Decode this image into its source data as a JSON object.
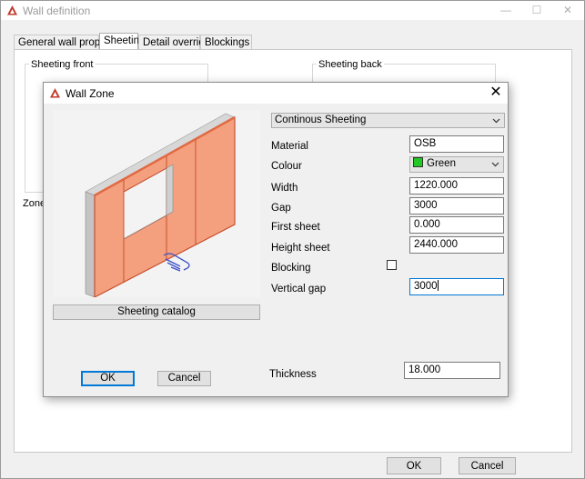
{
  "window": {
    "title": "Wall definition",
    "minimize_glyph": "—",
    "maximize_glyph": "☐",
    "close_glyph": "✕"
  },
  "tabs": [
    {
      "label": "General wall properties"
    },
    {
      "label": "Sheeting"
    },
    {
      "label": "Detail overrides"
    },
    {
      "label": "Blockings"
    }
  ],
  "sheeting_tab": {
    "front_label": "Sheeting front",
    "back_label": "Sheeting back",
    "zones_label": "Zones"
  },
  "main_buttons": {
    "ok": "OK",
    "cancel": "Cancel"
  },
  "dialog": {
    "title": "Wall Zone",
    "close_glyph": "✕",
    "type_value": "Continous Sheeting",
    "fields": {
      "material_label": "Material",
      "material_value": "OSB",
      "colour_label": "Colour",
      "colour_value": "Green",
      "width_label": "Width",
      "width_value": "1220.000",
      "gap_label": "Gap",
      "gap_value": "3000",
      "first_sheet_label": "First sheet",
      "first_sheet_value": "0.000",
      "height_sheet_label": "Height sheet",
      "height_sheet_value": "2440.000",
      "blocking_label": "Blocking",
      "vertical_gap_label": "Vertical gap",
      "vertical_gap_value": "3000",
      "thickness_label": "Thickness",
      "thickness_value": "18.000"
    },
    "catalog_button": "Sheeting catalog",
    "ok_button": "OK",
    "cancel_button": "Cancel"
  },
  "colors": {
    "sheet_fill": "#f4a07e",
    "sheet_edge": "#c8502e",
    "colour_swatch": "#22c922",
    "focus_accent": "#0078d7",
    "app_icon": "#c0392b"
  },
  "icons": [
    "app-icon",
    "close-icon",
    "chevron-down-icon",
    "hand-cursor-icon"
  ]
}
